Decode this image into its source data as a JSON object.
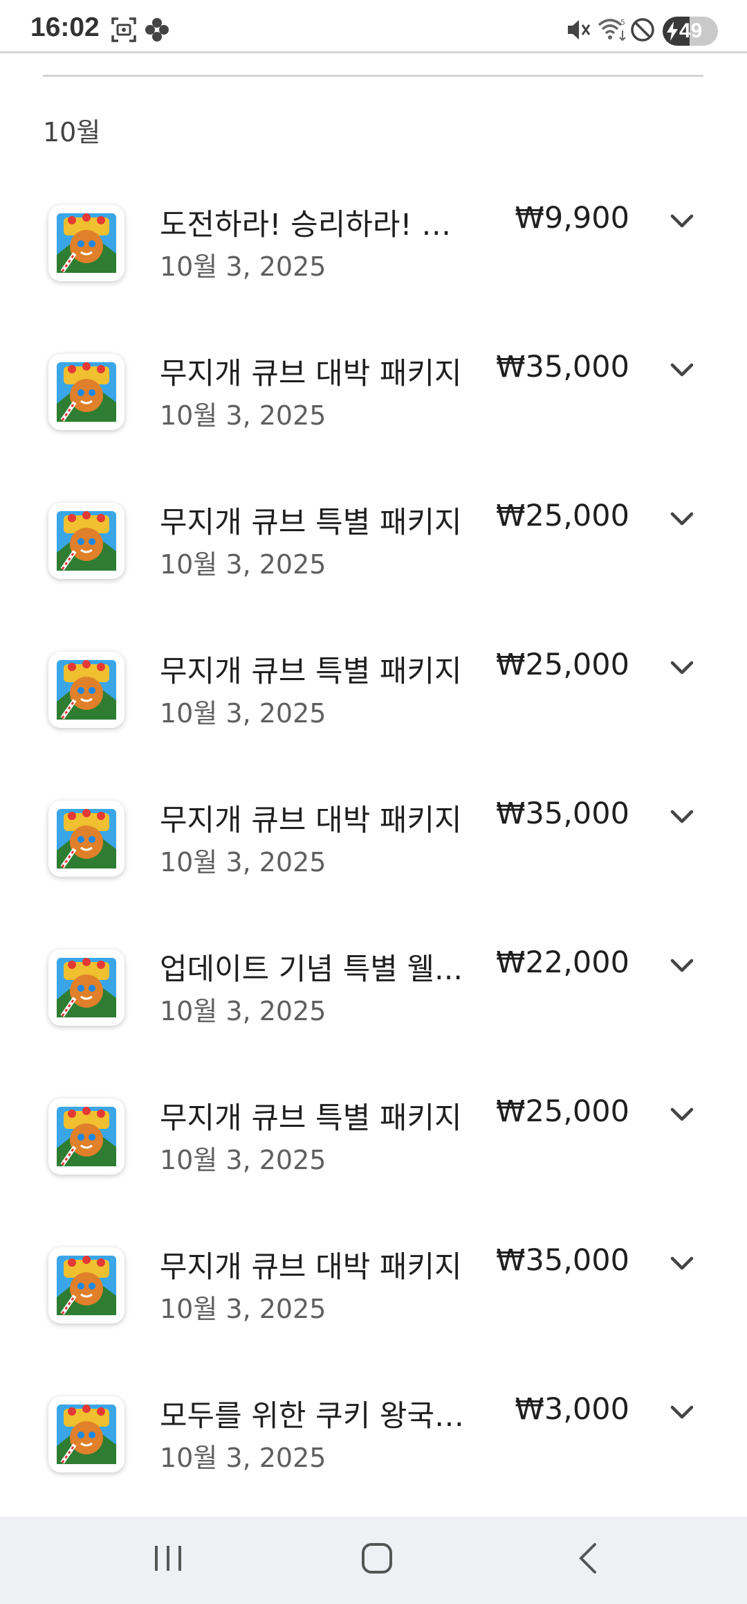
{
  "status_bar": {
    "time": "16:02",
    "battery": "49",
    "battery_level": 0.49,
    "icons": [
      "screenshot-icon",
      "pinwheel-icon",
      "mute-icon",
      "wifi-icon",
      "do-not-disturb-icon",
      "charging-icon"
    ]
  },
  "section": {
    "month": "10월"
  },
  "purchases": [
    {
      "title": "도전하라! 승리하라! 비...",
      "price": "₩9,900",
      "date": "10월 3, 2025"
    },
    {
      "title": "무지개 큐브 대박 패키지",
      "price": "₩35,000",
      "date": "10월 3, 2025"
    },
    {
      "title": "무지개 큐브 특별 패키지",
      "price": "₩25,000",
      "date": "10월 3, 2025"
    },
    {
      "title": "무지개 큐브 특별 패키지",
      "price": "₩25,000",
      "date": "10월 3, 2025"
    },
    {
      "title": "무지개 큐브 대박 패키지",
      "price": "₩35,000",
      "date": "10월 3, 2025"
    },
    {
      "title": "업데이트 기념 특별 웰...",
      "price": "₩22,000",
      "date": "10월 3, 2025"
    },
    {
      "title": "무지개 큐브 특별 패키지",
      "price": "₩25,000",
      "date": "10월 3, 2025"
    },
    {
      "title": "무지개 큐브 대박 패키지",
      "price": "₩35,000",
      "date": "10월 3, 2025"
    },
    {
      "title": "모두를 위한 쿠키 왕국 ...",
      "price": "₩3,000",
      "date": "10월 3, 2025"
    }
  ],
  "nav_bar": {
    "buttons": [
      "recent-apps-icon",
      "home-icon",
      "back-icon"
    ]
  },
  "colors": {
    "text_primary": "#1f1f1f",
    "text_secondary": "#5f5f5f",
    "nav_background": "#eef0f4"
  }
}
